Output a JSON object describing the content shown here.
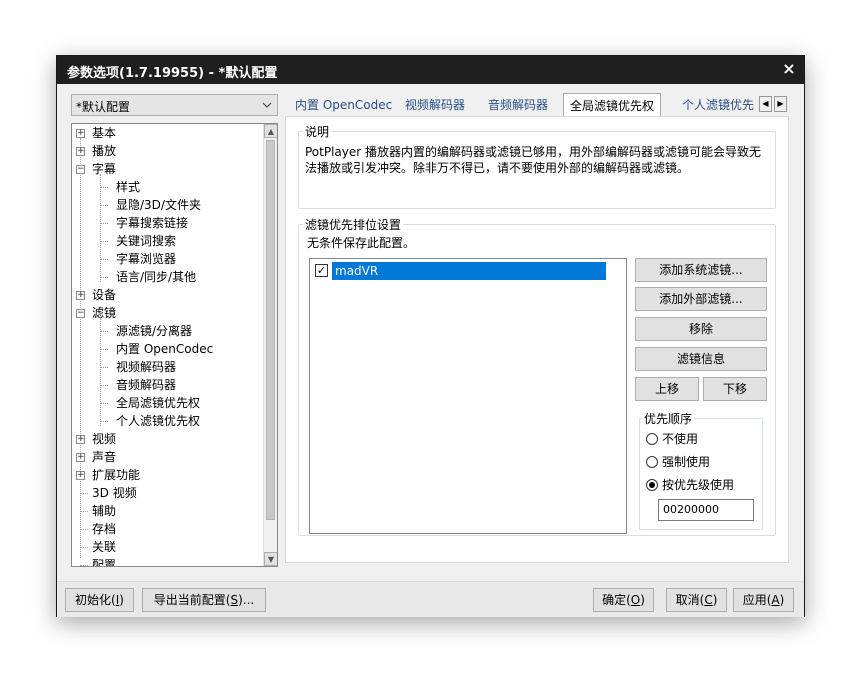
{
  "window": {
    "title": "参数选项(1.7.19955) - *默认配置",
    "close_glyph": "×"
  },
  "profile": {
    "selected": "*默认配置"
  },
  "tree": {
    "items": [
      {
        "label": "基本",
        "expander": "+"
      },
      {
        "label": "播放",
        "expander": "+"
      },
      {
        "label": "字幕",
        "expander": "−"
      },
      {
        "label": "样式"
      },
      {
        "label": "显隐/3D/文件夹"
      },
      {
        "label": "字幕搜索链接"
      },
      {
        "label": "关键词搜索"
      },
      {
        "label": "字幕浏览器"
      },
      {
        "label": "语言/同步/其他"
      },
      {
        "label": "设备",
        "expander": "+"
      },
      {
        "label": "滤镜",
        "expander": "−"
      },
      {
        "label": "源滤镜/分离器"
      },
      {
        "label": "内置 OpenCodec"
      },
      {
        "label": "视频解码器"
      },
      {
        "label": "音频解码器"
      },
      {
        "label": "全局滤镜优先权"
      },
      {
        "label": "个人滤镜优先权"
      },
      {
        "label": "视频",
        "expander": "+"
      },
      {
        "label": "声音",
        "expander": "+"
      },
      {
        "label": "扩展功能",
        "expander": "+"
      },
      {
        "label": "3D 视频"
      },
      {
        "label": "辅助"
      },
      {
        "label": "存档"
      },
      {
        "label": "关联"
      },
      {
        "label": "配置"
      }
    ]
  },
  "tabs": [
    "内置 OpenCodec",
    "视频解码器",
    "音频解码器",
    "全局滤镜优先权",
    "个人滤镜优先"
  ],
  "tab_scroll": {
    "left": "◀",
    "right": "▶"
  },
  "explanation": {
    "title": "说明",
    "text": "PotPlayer 播放器内置的编解码器或滤镜已够用，用外部编解码器或滤镜可能会导致无法播放或引发冲突。除非万不得已，请不要使用外部的编解码器或滤镜。"
  },
  "priority": {
    "title": "滤镜优先排位设置",
    "note": "无条件保存此配置。",
    "filters": [
      {
        "name": "madVR",
        "checked": true,
        "check_glyph": "✓"
      }
    ],
    "buttons": {
      "add_system": "添加系统滤镜...",
      "add_external": "添加外部滤镜...",
      "remove": "移除",
      "info": "滤镜信息",
      "move_up": "上移",
      "move_down": "下移"
    },
    "order": {
      "title": "优先顺序",
      "options": [
        "不使用",
        "强制使用",
        "按优先级使用"
      ],
      "selected": "按优先级使用",
      "value": "00200000"
    }
  },
  "footer": {
    "init": {
      "text": "初始化",
      "hotkey": "I"
    },
    "export": {
      "text": "导出当前配置",
      "hotkey": "S",
      "suffix": "..."
    },
    "ok": {
      "text": "确定",
      "hotkey": "O"
    },
    "cancel": {
      "text": "取消",
      "hotkey": "C"
    },
    "apply": {
      "text": "应用",
      "hotkey": "A"
    }
  },
  "colors": {
    "titlebar": "#1f1f1f",
    "selection": "#0078d7",
    "tab_text": "#2b4d8a"
  }
}
